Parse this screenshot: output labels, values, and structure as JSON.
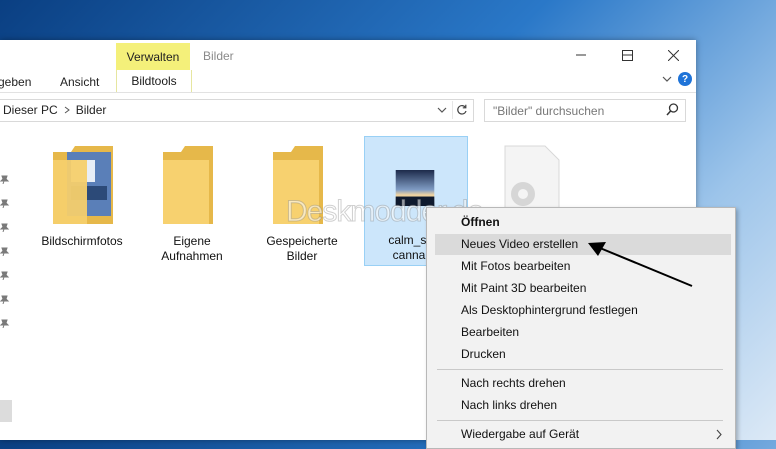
{
  "window": {
    "title": "Bilder",
    "contextual_tab_header": "Verwalten",
    "controls": {
      "minimize": "minimize-icon",
      "maximize": "maximize-icon",
      "close": "close-icon"
    }
  },
  "ribbon": {
    "tabs": [
      "geben",
      "Ansicht"
    ],
    "contextual_tab": "Bildtools"
  },
  "address": {
    "crumbs": [
      "Dieser PC",
      "Bilder"
    ],
    "search_placeholder": "\"Bilder\" durchsuchen"
  },
  "files": [
    {
      "label": "Bildschirmfotos",
      "icon": "folder-with-screenshot-icon"
    },
    {
      "label": "Eigene\nAufnahmen",
      "icon": "folder-icon"
    },
    {
      "label": "Gespeicherte\nBilder",
      "icon": "folder-icon"
    },
    {
      "label": "calm_suns\ncannabia",
      "icon": "image-thumbnail"
    },
    {
      "label": "",
      "icon": "file-settings-icon"
    }
  ],
  "context_menu": {
    "items": [
      {
        "label": "Öffnen",
        "bold": true
      },
      {
        "label": "Neues Video erstellen",
        "highlighted": true
      },
      {
        "label": "Mit Fotos bearbeiten"
      },
      {
        "label": "Mit Paint 3D bearbeiten"
      },
      {
        "label": "Als Desktophintergrund festlegen"
      },
      {
        "label": "Bearbeiten"
      },
      {
        "label": "Drucken"
      },
      {
        "label": "Nach rechts drehen"
      },
      {
        "label": "Nach links drehen"
      },
      {
        "label": "Wiedergabe auf Gerät",
        "submenu": true
      }
    ]
  },
  "watermark": "Deskmodder.de",
  "colors": {
    "contextual_tab": "#f4f07a",
    "selection": "#cce6fb",
    "help": "#1e73d8"
  }
}
